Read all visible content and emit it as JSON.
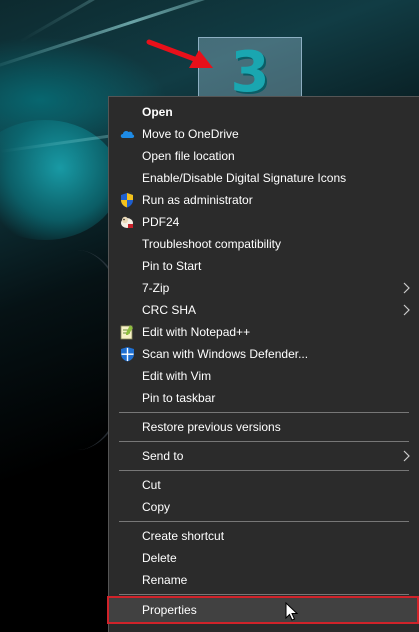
{
  "desktop": {
    "icon_glyph": "3"
  },
  "menu": {
    "items": [
      {
        "label": "Open",
        "icon": "none"
      },
      {
        "label": "Move to OneDrive",
        "icon": "onedrive-cloud-icon"
      },
      {
        "label": "Open file location",
        "icon": "none"
      },
      {
        "label": "Enable/Disable Digital Signature Icons",
        "icon": "none"
      },
      {
        "label": "Run as administrator",
        "icon": "uac-shield-icon"
      },
      {
        "label": "PDF24",
        "icon": "pdf24-sheep-icon"
      },
      {
        "label": "Troubleshoot compatibility",
        "icon": "none"
      },
      {
        "label": "Pin to Start",
        "icon": "none"
      },
      {
        "label": "7-Zip",
        "icon": "none",
        "submenu": true
      },
      {
        "label": "CRC SHA",
        "icon": "none",
        "submenu": true
      },
      {
        "label": "Edit with Notepad++",
        "icon": "notepadpp-icon"
      },
      {
        "label": "Scan with Windows Defender...",
        "icon": "windows-defender-icon"
      },
      {
        "label": "Edit with Vim",
        "icon": "none"
      },
      {
        "label": "Pin to taskbar",
        "icon": "none"
      },
      {
        "label": "Restore previous versions",
        "icon": "none"
      },
      {
        "label": "Send to",
        "icon": "none",
        "submenu": true
      },
      {
        "label": "Cut",
        "icon": "none"
      },
      {
        "label": "Copy",
        "icon": "none"
      },
      {
        "label": "Create shortcut",
        "icon": "none"
      },
      {
        "label": "Delete",
        "icon": "none"
      },
      {
        "label": "Rename",
        "icon": "none"
      },
      {
        "label": "Properties",
        "icon": "none",
        "highlighted": true
      }
    ]
  },
  "colors": {
    "menu_bg": "#2b2b2b",
    "highlight_outline": "#d0232a",
    "arrow": "#e8101a"
  }
}
